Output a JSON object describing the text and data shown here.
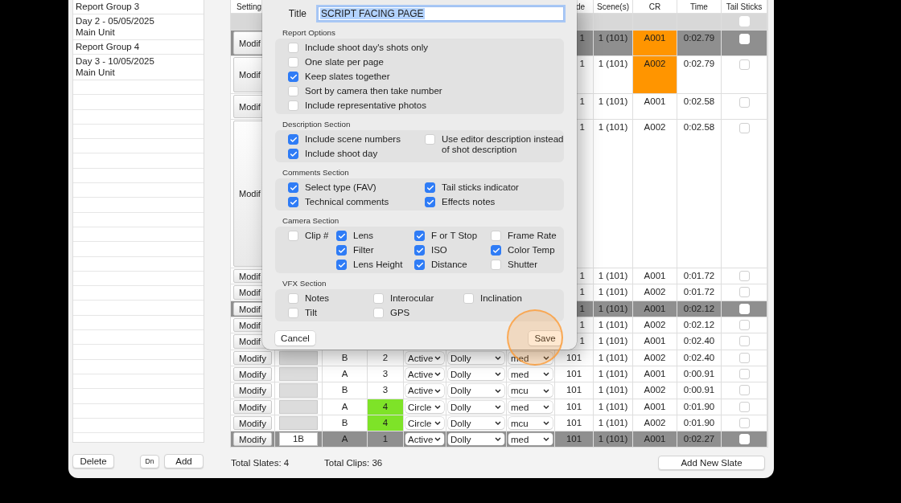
{
  "sidebar": {
    "items": [
      {
        "kind": "group",
        "title": "Report Group 3"
      },
      {
        "kind": "day",
        "title": "Day 2 - 05/05/2025",
        "subtitle": "Main Unit"
      },
      {
        "kind": "group",
        "title": "Report Group 4"
      },
      {
        "kind": "day",
        "title": "Day 3 - 10/05/2025",
        "subtitle": "Main Unit"
      }
    ],
    "buttons": [
      {
        "kind": "delete",
        "label": "Delete"
      },
      {
        "kind": "down",
        "label": "Dn"
      },
      {
        "kind": "add",
        "label": "Add"
      }
    ]
  },
  "table": {
    "columns": {
      "settings": "Setting",
      "column_8": "de",
      "scenes": "Scene(s)",
      "cr": "CR",
      "time": "Time",
      "tail_sticks": "Tail Sticks"
    },
    "rows": [
      {
        "kind": "group",
        "selected": false,
        "tail_sticks": false
      },
      {
        "kind": "clip",
        "selected": true,
        "settings": "Modif",
        "column_8": "1",
        "scenes": "1 (101)",
        "cr": {
          "text": "A001",
          "color": "#ff9500"
        },
        "time": "0:02.79",
        "tail_sticks": false
      },
      {
        "kind": "clip",
        "selected": false,
        "settings": "Modif",
        "column_8": "1",
        "scenes": "1 (101)",
        "cr": {
          "text": "A002",
          "color": "#ff9500"
        },
        "time": "0:02.79",
        "tail_sticks": false
      },
      {
        "kind": "clip",
        "selected": false,
        "settings": "Modif",
        "column_8": "1",
        "scenes": "1 (101)",
        "cr": "A001",
        "time": "0:02.58",
        "tail_sticks": false
      },
      {
        "kind": "clip",
        "selected": false,
        "settings": "Modif",
        "column_8": "1",
        "scenes": "1 (101)",
        "cr": "A002",
        "time": "0:02.58",
        "tail_sticks": false
      },
      {
        "kind": "clip",
        "selected": false,
        "settings": "Modif",
        "column_8": "1",
        "scenes": "1 (101)",
        "cr": "A001",
        "time": "0:01.72",
        "tail_sticks": false
      },
      {
        "kind": "clip",
        "selected": false,
        "settings": "Modif",
        "column_8": "1",
        "scenes": "1 (101)",
        "cr": "A002",
        "time": "0:01.72",
        "tail_sticks": false
      },
      {
        "kind": "clip",
        "selected": true,
        "settings": "Modif",
        "column_8": "1",
        "scenes": "1 (101)",
        "cr": "A001",
        "time": "0:02.12",
        "tail_sticks": false
      },
      {
        "kind": "clip",
        "selected": false,
        "settings": "Modif",
        "column_8": "1",
        "scenes": "1 (101)",
        "cr": "A002",
        "time": "0:02.12",
        "tail_sticks": false
      },
      {
        "kind": "clip",
        "selected": false,
        "settings": "Modif",
        "column_8": "1",
        "scenes": "1 (101)",
        "cr": "A001",
        "time": "0:02.40",
        "tail_sticks": false
      },
      {
        "kind": "clip",
        "selected": false,
        "settings": "Modify",
        "camera": "B",
        "take": "2",
        "select": "Active",
        "rig": "Dolly",
        "size": "med",
        "column_8": "101",
        "scenes": "1 (101)",
        "cr": "A002",
        "time": "0:02.40",
        "tail_sticks": false
      },
      {
        "kind": "clip",
        "selected": false,
        "settings": "Modify",
        "camera": "A",
        "take": "3",
        "select": "Active",
        "rig": "Dolly",
        "size": "med",
        "column_8": "101",
        "scenes": "1 (101)",
        "cr": "A001",
        "time": "0:00.91",
        "tail_sticks": false
      },
      {
        "kind": "clip",
        "selected": false,
        "settings": "Modify",
        "camera": "B",
        "take": "3",
        "select": "Active",
        "rig": "Dolly",
        "size": "mcu",
        "column_8": "101",
        "scenes": "1 (101)",
        "cr": "A002",
        "time": "0:00.91",
        "tail_sticks": false
      },
      {
        "kind": "clip",
        "selected": false,
        "settings": "Modify",
        "camera": "A",
        "take": {
          "text": "4",
          "color": "#7ee328"
        },
        "select": "Circle",
        "rig": "Dolly",
        "size": "med",
        "column_8": "101",
        "scenes": "1 (101)",
        "cr": "A001",
        "time": "0:01.90",
        "tail_sticks": false
      },
      {
        "kind": "clip",
        "selected": false,
        "settings": "Modify",
        "camera": "B",
        "take": {
          "text": "4",
          "color": "#7ee328"
        },
        "select": "Circle",
        "rig": "Dolly",
        "size": "mcu",
        "column_8": "101",
        "scenes": "1 (101)",
        "cr": "A002",
        "time": "0:01.90",
        "tail_sticks": false
      },
      {
        "kind": "clip",
        "selected": true,
        "settings": "Modify",
        "slate": "1B",
        "camera": "A",
        "take": "1",
        "select": "Active",
        "rig": "Dolly",
        "size": "med",
        "column_8": "101",
        "scenes": "1 (101)",
        "cr": "A001",
        "time": "0:02.27",
        "tail_sticks": false
      }
    ]
  },
  "status_bar": {
    "slates": "Total Slates: 4",
    "clips": "Total Clips: 36",
    "button": "Add New Slate"
  },
  "dialog": {
    "title_label": "Title",
    "title_value": "SCRIPT FACING PAGE",
    "title_selected": true,
    "sections": [
      {
        "title": "Report Options",
        "columns": [
          [
            {
              "label": "Include shoot day's shots only",
              "checked": false
            },
            {
              "label": "One slate per page",
              "checked": false
            },
            {
              "label": "Keep slates together",
              "checked": true
            },
            {
              "label": "Sort by camera then take number",
              "checked": false
            },
            {
              "label": "Include representative photos",
              "checked": false
            }
          ]
        ]
      },
      {
        "title": "Description Section",
        "columns": [
          [
            {
              "label": "Include scene numbers",
              "checked": true
            },
            {
              "label": "Include shoot day",
              "checked": true
            }
          ],
          [
            {
              "label": "Use editor description instead of shot description",
              "checked": false
            }
          ]
        ]
      },
      {
        "title": "Comments Section",
        "columns": [
          [
            {
              "label": "Select type (FAV)",
              "checked": true
            },
            {
              "label": "Technical comments",
              "checked": true
            }
          ],
          [
            {
              "label": "Tail sticks indicator",
              "checked": true
            },
            {
              "label": "Effects notes",
              "checked": true
            }
          ]
        ]
      },
      {
        "title": "Camera Section",
        "columns": [
          [
            {
              "label": "Clip #",
              "checked": false
            }
          ],
          [
            {
              "label": "Lens",
              "checked": true
            },
            {
              "label": "Filter",
              "checked": true
            },
            {
              "label": "Lens Height",
              "checked": true
            }
          ],
          [
            {
              "label": "F or T Stop",
              "checked": true
            },
            {
              "label": "ISO",
              "checked": true
            },
            {
              "label": "Distance",
              "checked": true
            }
          ],
          [
            {
              "label": "Frame Rate",
              "checked": false
            },
            {
              "label": "Color Temp",
              "checked": true
            },
            {
              "label": "Shutter",
              "checked": false
            }
          ]
        ]
      },
      {
        "title": "VFX Section",
        "columns": [
          [
            {
              "label": "Notes",
              "checked": false
            },
            {
              "label": "Tilt",
              "checked": false
            }
          ],
          [
            {
              "label": "Interocular",
              "checked": false
            },
            {
              "label": "GPS",
              "checked": false
            }
          ],
          [
            {
              "label": "Inclination",
              "checked": false
            }
          ]
        ]
      }
    ],
    "buttons": [
      {
        "kind": "cancel",
        "label": "Cancel",
        "clicked": false
      },
      {
        "kind": "save",
        "label": "Save",
        "clicked": true
      }
    ]
  }
}
